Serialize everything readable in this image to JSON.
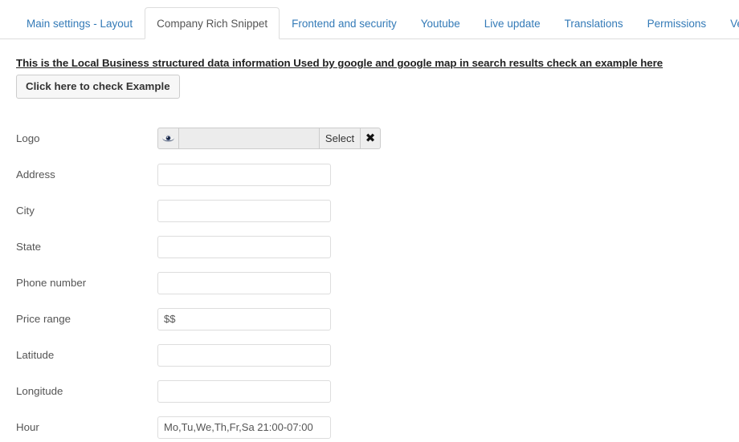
{
  "tabs": [
    {
      "label": "Main settings - Layout",
      "active": false
    },
    {
      "label": "Company Rich Snippet",
      "active": true
    },
    {
      "label": "Frontend and security",
      "active": false
    },
    {
      "label": "Youtube",
      "active": false
    },
    {
      "label": "Live update",
      "active": false
    },
    {
      "label": "Translations",
      "active": false
    },
    {
      "label": "Permissions",
      "active": false
    },
    {
      "label": "Versions",
      "active": false
    }
  ],
  "content": {
    "lead_note": "This is the Local Business structured data information Used by google and google map in search results check an example here",
    "example_button_label": "Click here to check Example"
  },
  "logo_row": {
    "label": "Logo",
    "preview_icon": "eye-icon",
    "path_value": "",
    "path_placeholder": "",
    "select_label": "Select",
    "clear_icon": "close-icon"
  },
  "fields": [
    {
      "label": "Address",
      "value": "",
      "placeholder": ""
    },
    {
      "label": "City",
      "value": "",
      "placeholder": ""
    },
    {
      "label": "State",
      "value": "",
      "placeholder": ""
    },
    {
      "label": "Phone number",
      "value": "",
      "placeholder": ""
    },
    {
      "label": "Price range",
      "value": "$$",
      "placeholder": ""
    },
    {
      "label": "Latitude",
      "value": "",
      "placeholder": ""
    },
    {
      "label": "Longitude",
      "value": "",
      "placeholder": ""
    },
    {
      "label": "Hour",
      "value": "Mo,Tu,We,Th,Fr,Sa 21:00-07:00",
      "placeholder": ""
    }
  ],
  "colors": {
    "link": "#337ab7",
    "active_tab_text": "#555555",
    "border": "#dddddd",
    "button_face": "#f7f7f7",
    "addon_face": "#eeeeee",
    "text": "#555555"
  }
}
